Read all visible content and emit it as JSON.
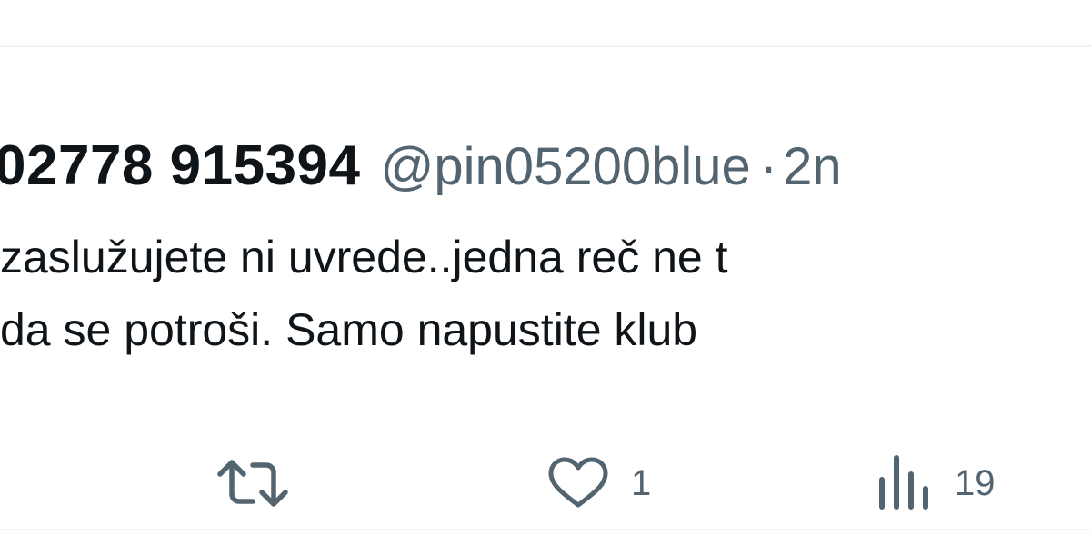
{
  "tweet": {
    "display_name": "02778 915394",
    "handle": "@pin05200blue",
    "separator": "·",
    "time": "2n",
    "text_line1": "zaslužujete ni uvrede..jedna reč ne t",
    "text_line2": "da se potroši. Samo napustite klub"
  },
  "actions": {
    "retweet_icon": "retweet-icon",
    "like_icon": "heart-icon",
    "like_count": "1",
    "views_icon": "bar-chart-icon",
    "views_count": "19"
  },
  "colors": {
    "text_primary": "#0f1419",
    "text_secondary": "#536471",
    "divider": "#eff3f4"
  }
}
